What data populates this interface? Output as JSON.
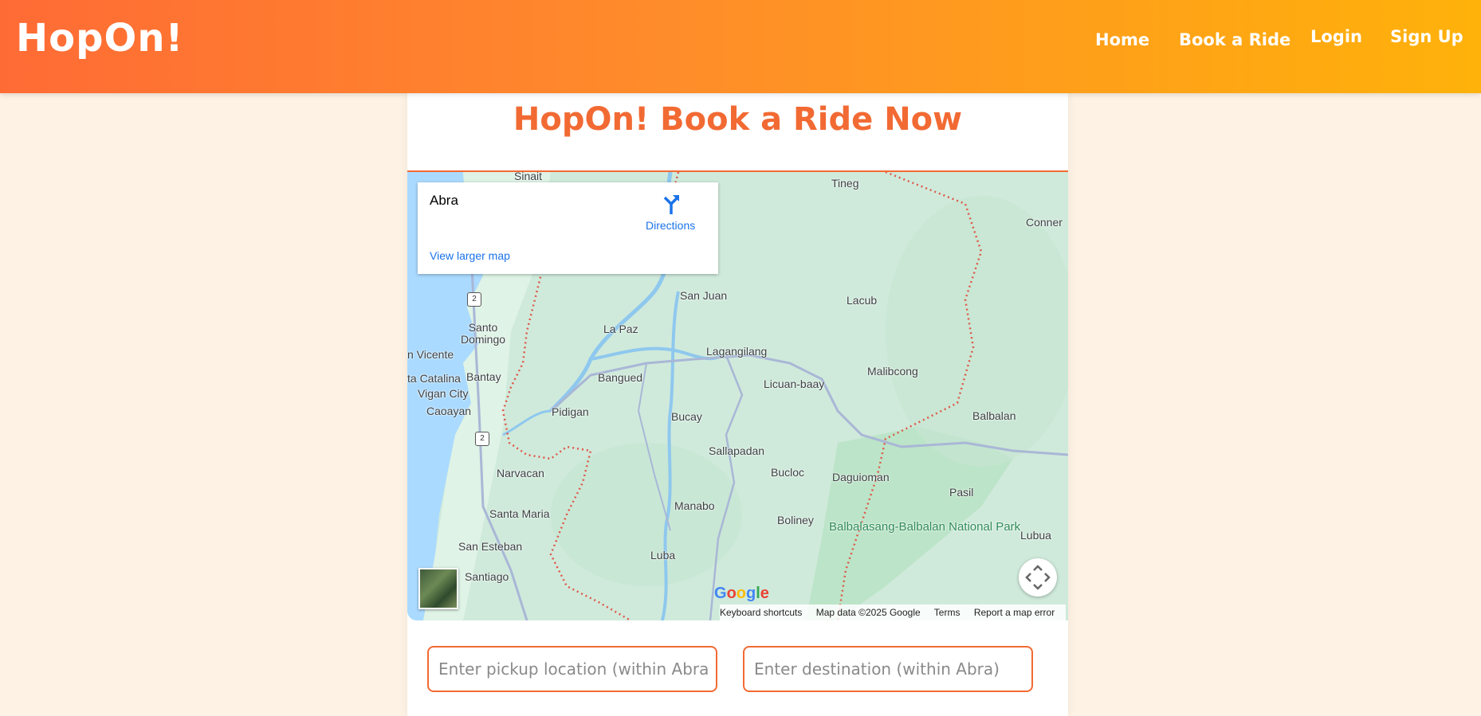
{
  "header": {
    "brand": "HopOn!",
    "nav": [
      {
        "label": "Home"
      },
      {
        "label": "Book a Ride"
      },
      {
        "label": "Login"
      },
      {
        "label": "Sign Up"
      }
    ]
  },
  "main": {
    "title": "HopOn! Book a Ride Now"
  },
  "map": {
    "info": {
      "place": "Abra",
      "directions_label": "Directions",
      "view_larger": "View larger map"
    },
    "labels": [
      "Sinait",
      "Tineg",
      "Conner",
      "San Juan",
      "Lacub",
      "Santo Domingo",
      "La Paz",
      "Lagangilang",
      "n Vicente",
      "Malibcong",
      "Bantay",
      "Bangued",
      "ta Catalina",
      "Licuan-baay",
      "Vigan City",
      "Caoayan",
      "Pidigan",
      "Bucay",
      "Balbalan",
      "Sallapadan",
      "Narvacan",
      "Bucloc",
      "Daguioman",
      "Pasil",
      "Manabo",
      "Santa Maria",
      "Boliney",
      "San Esteban",
      "Luba",
      "Lubua",
      "Santiago"
    ],
    "park_label": "Balbalasang-Balbalan National Park",
    "route_shields": [
      "2",
      "2"
    ],
    "google_logo": "Google",
    "attribution": {
      "shortcuts": "Keyboard shortcuts",
      "data": "Map data ©2025 Google",
      "terms": "Terms",
      "report": "Report a map error"
    }
  },
  "form": {
    "pickup_placeholder": "Enter pickup location (within Abra)",
    "destination_placeholder": "Enter destination (within Abra)"
  },
  "colors": {
    "accent": "#f26a33",
    "header_start": "#ff6b35",
    "header_end": "#ffb20a",
    "link": "#1a73e8",
    "page_bg": "#fdf2e4"
  }
}
